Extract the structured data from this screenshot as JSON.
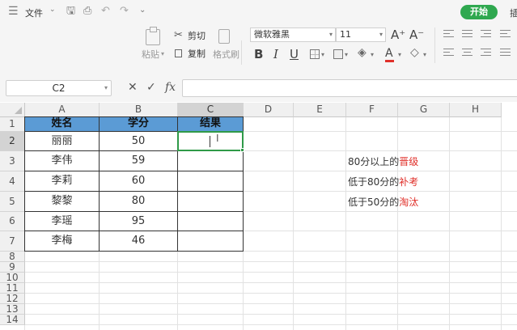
{
  "titlebar": {
    "menu_label": "文件",
    "start_tab": "开始",
    "more_tab": "插"
  },
  "ribbon": {
    "paste_label": "粘贴",
    "cut_label": "剪切",
    "copy_label": "复制",
    "format_painter_label": "格式刷",
    "font_name": "微软雅黑",
    "font_size": "11",
    "bold": "B",
    "italic": "I",
    "underline": "U",
    "grow_font": "A⁺",
    "shrink_font": "A⁻",
    "font_color_glyph": "A",
    "font_color": "#e0302a"
  },
  "formula_bar": {
    "name_box": "C2",
    "fx_label": "fx",
    "cancel_glyph": "✕",
    "enter_glyph": "✓",
    "value": ""
  },
  "sheet": {
    "columns": [
      "A",
      "B",
      "C",
      "D",
      "E",
      "F",
      "G",
      "H"
    ],
    "selected_column": "C",
    "rows": [
      "1",
      "2",
      "3",
      "4",
      "5",
      "6",
      "7",
      "8",
      "9",
      "10",
      "11",
      "12",
      "13",
      "14"
    ],
    "selected_row": "2",
    "header_fill": "#5b9bd5",
    "table_header": [
      "姓名",
      "学分",
      "结果"
    ],
    "table_rows": [
      [
        "丽丽",
        "50",
        ""
      ],
      [
        "李伟",
        "59",
        ""
      ],
      [
        "李莉",
        "60",
        ""
      ],
      [
        "黎黎",
        "80",
        ""
      ],
      [
        "李瑶",
        "95",
        ""
      ],
      [
        "李梅",
        "46",
        ""
      ]
    ],
    "active_cell": "C2",
    "notes": [
      {
        "prefix": "80分以上的",
        "highlight": "晋级"
      },
      {
        "prefix": "低于80分的",
        "highlight": "补考"
      },
      {
        "prefix": "低于50分的",
        "highlight": "淘汰"
      }
    ],
    "note_highlight_color": "#e0302a",
    "selection_color": "#2f9a48"
  }
}
